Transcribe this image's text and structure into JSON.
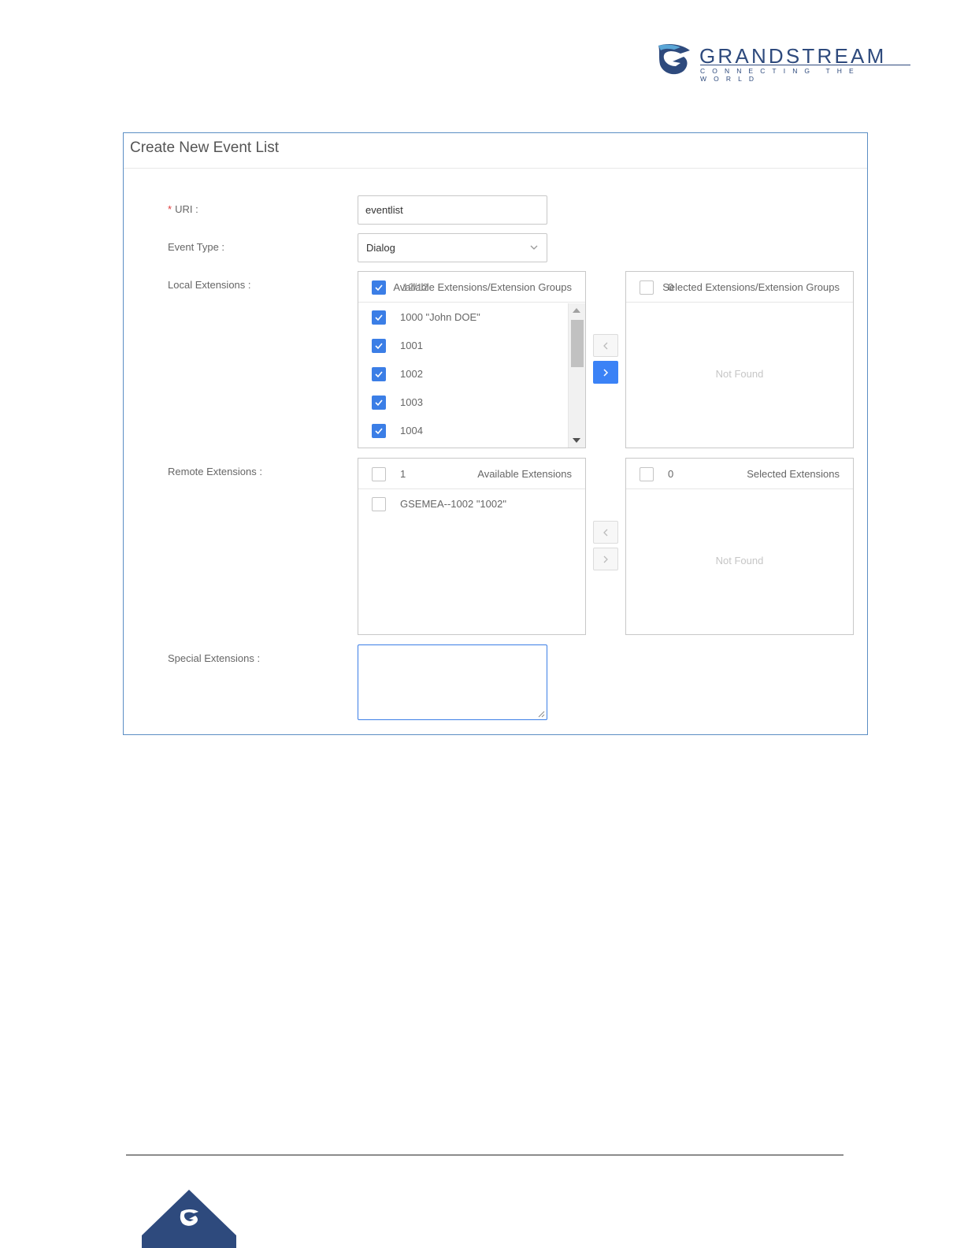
{
  "brand": {
    "name": "GRANDSTREAM",
    "tagline": "CONNECTING THE WORLD",
    "color": "#2e4a7d"
  },
  "dialog": {
    "title": "Create New Event List",
    "border_color": "#5b8ec4"
  },
  "form": {
    "uri": {
      "required_mark": "*",
      "label": "URI :",
      "value": "eventlist"
    },
    "event_type": {
      "label": "Event Type :",
      "selected": "Dialog"
    },
    "local_extensions": {
      "label": "Local Extensions :",
      "available": {
        "title": "Available Extensions/Extension Groups",
        "count": "12/12",
        "all_checked": true,
        "items": [
          {
            "label": "1000 \"John DOE\"",
            "checked": true
          },
          {
            "label": "1001",
            "checked": true
          },
          {
            "label": "1002",
            "checked": true
          },
          {
            "label": "1003",
            "checked": true
          },
          {
            "label": "1004",
            "checked": true
          }
        ]
      },
      "selected": {
        "title": "Selected Extensions/Extension Groups",
        "count": "0",
        "empty_text": "Not Found"
      }
    },
    "remote_extensions": {
      "label": "Remote Extensions :",
      "available": {
        "title": "Available Extensions",
        "count": "1",
        "items": [
          {
            "label": "GSEMEA--1002 \"1002\"",
            "checked": false
          }
        ]
      },
      "selected": {
        "title": "Selected Extensions",
        "count": "0",
        "empty_text": "Not Found"
      }
    },
    "special_extensions": {
      "label": "Special Extensions :",
      "value": ""
    }
  },
  "colors": {
    "accent": "#3b82f6",
    "required": "#e03c3c"
  }
}
